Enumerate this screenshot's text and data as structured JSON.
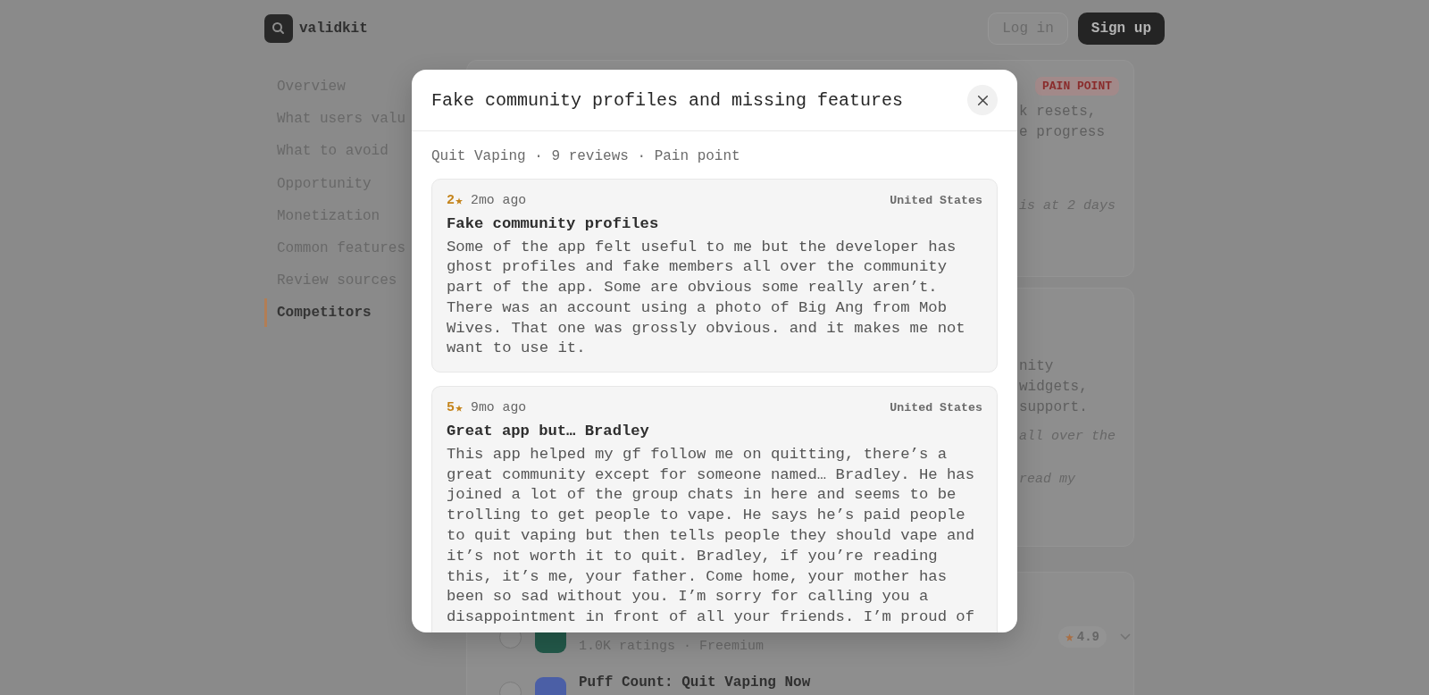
{
  "header": {
    "logo": "validkit",
    "buttons": [
      {
        "label": "Log in",
        "kind": "secondary"
      },
      {
        "label": "Sign up",
        "kind": "primary"
      }
    ]
  },
  "sidebar": {
    "items": [
      {
        "label": "Overview",
        "selected": false
      },
      {
        "label": "What users valu",
        "selected": false
      },
      {
        "label": "What to avoid",
        "selected": false
      },
      {
        "label": "Opportunity",
        "selected": false
      },
      {
        "label": "Monetization",
        "selected": false
      },
      {
        "label": "Common features",
        "selected": false
      },
      {
        "label": "Review sources",
        "selected": false
      },
      {
        "label": "Competitors",
        "selected": true
      }
    ]
  },
  "main": {
    "cards": [
      {
        "badge": "PAIN POINT",
        "lines": [
          {
            "kind": "text",
            "text": "k resets,"
          },
          {
            "kind": "text",
            "text": "e progress"
          },
          {
            "kind": "quote",
            "text": "is at 2 days"
          }
        ]
      },
      {
        "lines": [
          {
            "kind": "text",
            "text": "nity"
          },
          {
            "kind": "text",
            "text": "widgets,"
          },
          {
            "kind": "text",
            "text": "support."
          },
          {
            "kind": "quote",
            "text": "all over the"
          },
          {
            "kind": "quote",
            "text": "read my"
          }
        ]
      }
    ],
    "competitors": [
      {
        "subtitle": "1.0K ratings · Freemium",
        "rating": "4.9",
        "color": "#23594a"
      },
      {
        "title": "Puff Count: Quit Vaping Now",
        "color": "#4b5fa6"
      }
    ]
  },
  "modal": {
    "title": "Fake community profiles and missing features",
    "subtitle": "Quit Vaping · 9 reviews · Pain point",
    "reviews": [
      {
        "rating": "2",
        "age": "2mo ago",
        "country": "United States",
        "title": "Fake community profiles",
        "body": "Some of the app felt useful to me but the developer has ghost profiles and fake members all over the community part of the app. Some are obvious some really aren’t. There was an account using a photo of Big Ang from Mob Wives. That one was grossly obvious. and it makes me not want to use it."
      },
      {
        "rating": "5",
        "age": "9mo ago",
        "country": "United States",
        "title": "Great app but… Bradley",
        "body": "This app helped my gf follow me on quitting, there’s a great community except for someone named… Bradley. He has joined a lot of the group chats in here and seems to be trolling to get people to vape. He says he’s paid people to quit vaping but then tells people they should vape and it’s not worth it to quit. Bradley, if you’re reading this, it’s me, your father. Come home, your mother has been so sad without you. I’m sorry for calling you a disappointment in front of all your friends. I’m proud of"
      }
    ]
  }
}
